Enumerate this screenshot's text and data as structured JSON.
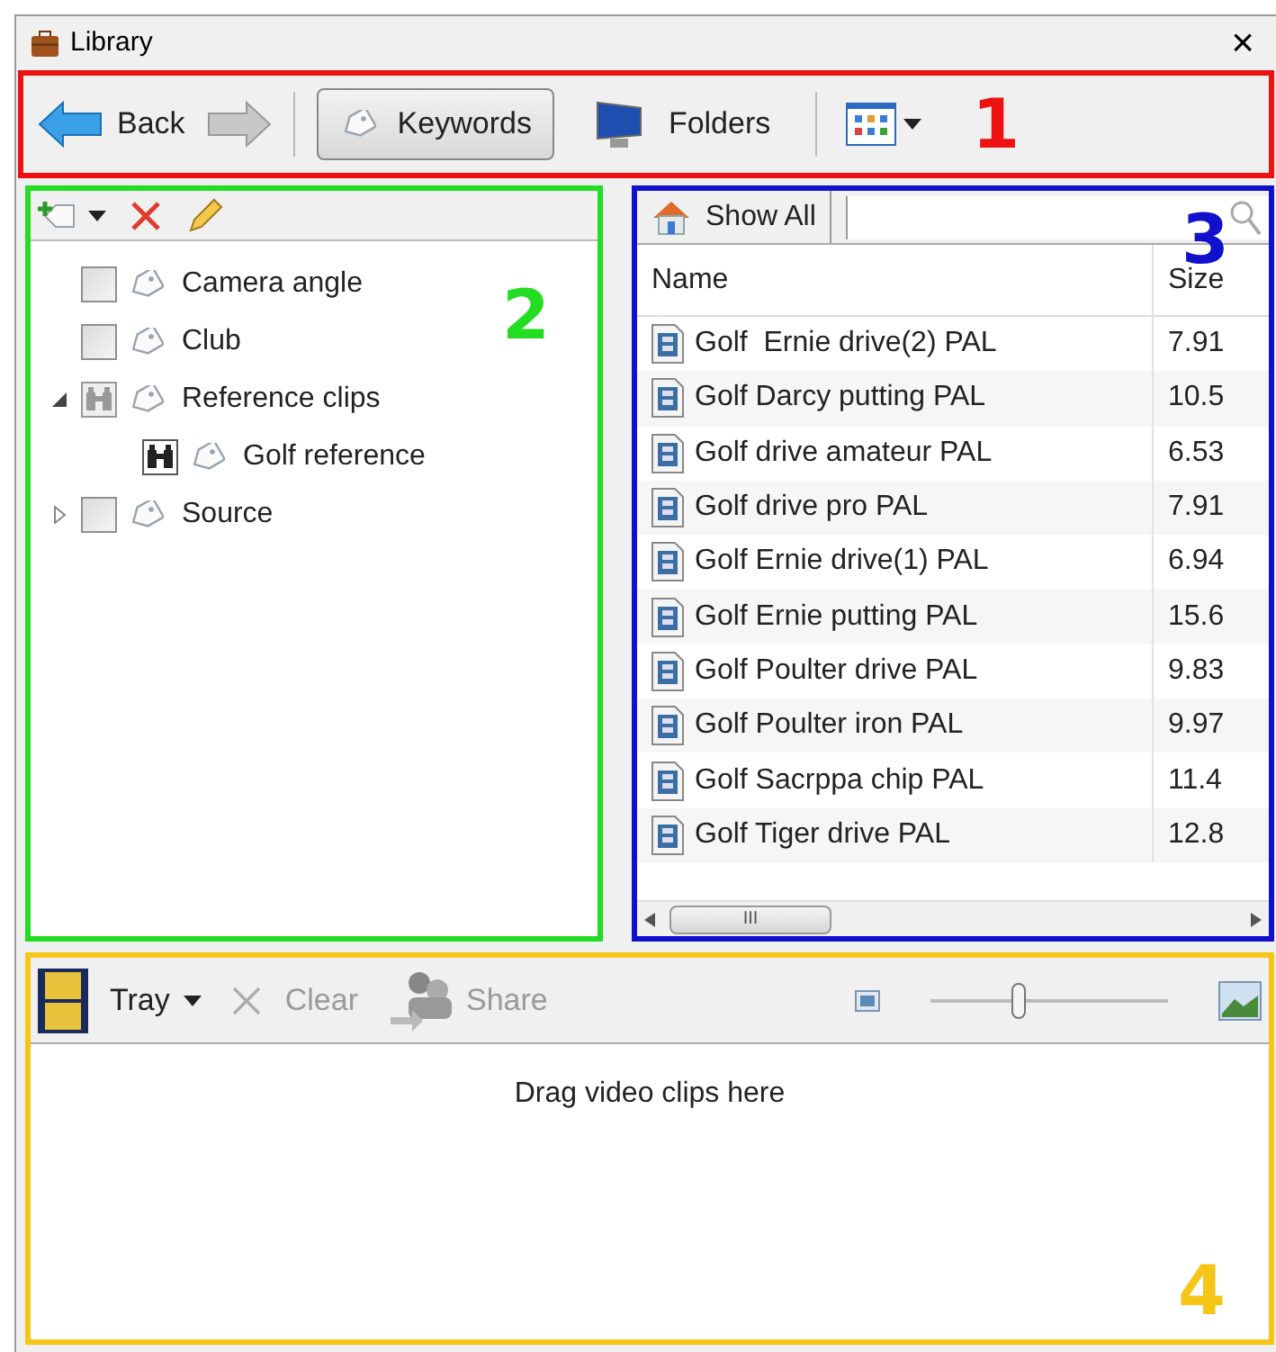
{
  "window": {
    "title": "Library",
    "close": "×"
  },
  "toolbar": {
    "callout": {
      "number": "1",
      "color": "#ee1111"
    },
    "back": {
      "label": "Back",
      "disabled": false
    },
    "forward": {
      "disabled": true
    },
    "views": [
      {
        "label": "Keywords",
        "kind": "keywords",
        "selected": true
      },
      {
        "label": "Folders",
        "kind": "folders",
        "selected": false
      }
    ]
  },
  "keywords_panel": {
    "callout": {
      "number": "2",
      "color": "#22dd22"
    },
    "items": [
      {
        "label": "Camera angle",
        "kind": "checkbox",
        "checked": false
      },
      {
        "label": "Club",
        "kind": "checkbox",
        "checked": false
      },
      {
        "label": "Reference clips",
        "kind": "binoculars",
        "checked": false,
        "expanded": true,
        "children": [
          {
            "label": "Golf reference",
            "kind": "binoculars",
            "checked": true
          }
        ]
      },
      {
        "label": "Source",
        "kind": "checkbox",
        "checked": false,
        "expanded": false
      }
    ]
  },
  "clips_panel": {
    "callout": {
      "number": "3",
      "color": "#1111cc"
    },
    "show_all": "Show All",
    "columns": [
      "Name",
      "Size"
    ],
    "rows": [
      {
        "name": "Golf  Ernie drive(2) PAL",
        "size": "7.91"
      },
      {
        "name": "Golf Darcy putting PAL",
        "size": "10.5"
      },
      {
        "name": "Golf drive amateur PAL",
        "size": "6.53"
      },
      {
        "name": "Golf drive pro PAL",
        "size": "7.91"
      },
      {
        "name": "Golf Ernie drive(1) PAL",
        "size": "6.94"
      },
      {
        "name": "Golf Ernie putting PAL",
        "size": "15.6"
      },
      {
        "name": "Golf Poulter drive PAL",
        "size": "9.83"
      },
      {
        "name": "Golf Poulter iron PAL",
        "size": "9.97"
      },
      {
        "name": "Golf Sacrppa chip PAL",
        "size": "11.4"
      },
      {
        "name": "Golf Tiger drive PAL",
        "size": "12.8"
      }
    ],
    "scrollbar_grip": "III"
  },
  "tray": {
    "callout": {
      "number": "4",
      "color": "#f5c518"
    },
    "tray_label": "Tray",
    "clear": {
      "label": "Clear",
      "disabled": true
    },
    "share": {
      "label": "Share",
      "disabled": true
    },
    "zoom": {
      "level": 0.37
    },
    "empty_text": "Drag video clips here"
  }
}
